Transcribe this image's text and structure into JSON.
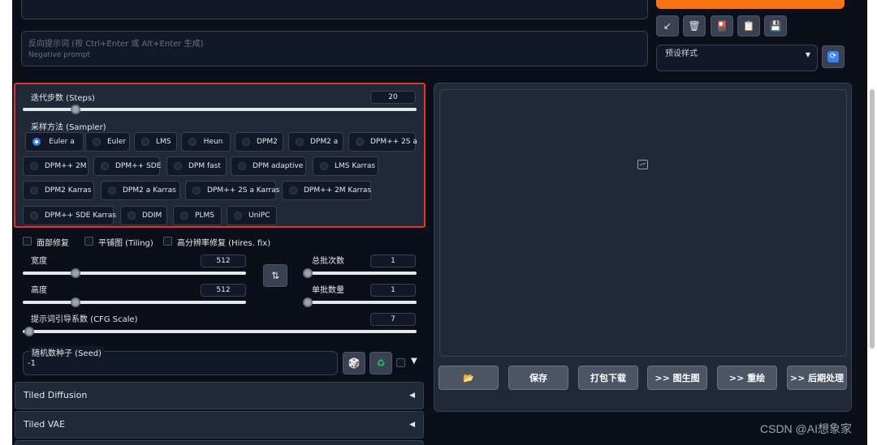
{
  "prompt": {
    "negative_placeholder_line1": "反向提示词 (按 Ctrl+Enter 或 Alt+Enter 生成)",
    "negative_placeholder_line2": "Negative prompt"
  },
  "tools": {
    "icons": [
      "arrow-icon",
      "trash-icon",
      "card-icon",
      "clipboard-icon",
      "save-icon"
    ],
    "glyphs": [
      "↙",
      "🗑",
      "🎴",
      "📋",
      "💾"
    ]
  },
  "styles": {
    "label": "预设样式",
    "refresh_glyph": "🔄"
  },
  "steps": {
    "label": "迭代步数 (Steps)",
    "value": "20"
  },
  "sampler": {
    "label": "采样方法 (Sampler)",
    "selected": "Euler a",
    "options": [
      "Euler a",
      "Euler",
      "LMS",
      "Heun",
      "DPM2",
      "DPM2 a",
      "DPM++ 2S a",
      "DPM++ 2M",
      "DPM++ SDE",
      "DPM fast",
      "DPM adaptive",
      "LMS Karras",
      "DPM2 Karras",
      "DPM2 a Karras",
      "DPM++ 2S a Karras",
      "DPM++ 2M Karras",
      "DPM++ SDE Karras",
      "DDIM",
      "PLMS",
      "UniPC"
    ]
  },
  "checks": {
    "face_restore": "面部修复",
    "tiling": "平铺图 (Tiling)",
    "hires": "高分辨率修复 (Hires. fix)"
  },
  "width": {
    "label": "宽度",
    "value": "512"
  },
  "height": {
    "label": "高度",
    "value": "512"
  },
  "batch_count": {
    "label": "总批次数",
    "value": "1"
  },
  "batch_size": {
    "label": "单批数量",
    "value": "1"
  },
  "swap_glyph": "⇅",
  "cfg": {
    "label": "提示词引导系数 (CFG Scale)",
    "value": "7"
  },
  "seed": {
    "label": "随机数种子 (Seed)",
    "value": "-1",
    "dice_glyph": "🎲",
    "recycle_glyph": "♻",
    "extra_arrow": "▼"
  },
  "accordions": [
    {
      "title": "Tiled Diffusion",
      "arrow": "◀"
    },
    {
      "title": "Tiled VAE",
      "arrow": "◀"
    }
  ],
  "actions": {
    "folder_glyph": "📂",
    "save": "保存",
    "zip": "打包下载",
    "img2img": ">> 图生图",
    "inpaint": ">> 重绘",
    "extras": ">> 后期处理"
  },
  "watermark": "CSDN @AI想象家"
}
